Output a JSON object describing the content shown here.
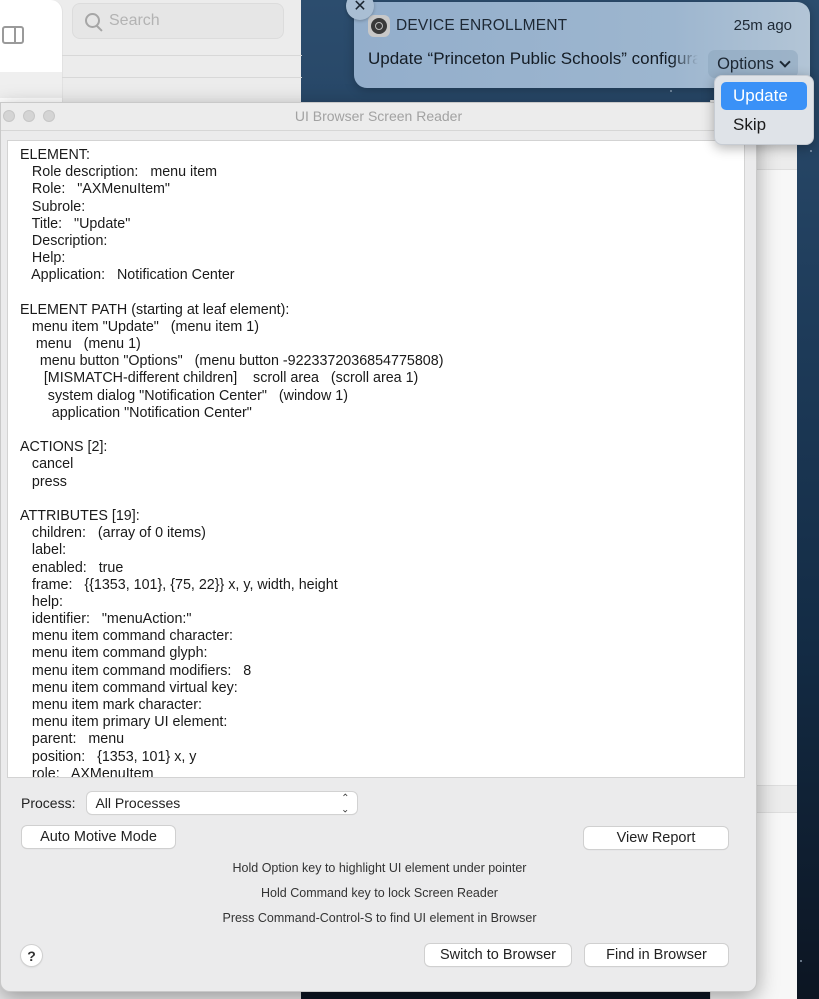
{
  "background_app": {
    "search": {
      "placeholder": "Search"
    }
  },
  "window": {
    "title": "UI Browser Screen Reader"
  },
  "reader": {
    "lines": [
      "ELEMENT:",
      "   Role description:   menu item",
      "   Role:   \"AXMenuItem\"",
      "   Subrole:",
      "   Title:   \"Update\"",
      "   Description:",
      "   Help:",
      "   Application:   Notification Center",
      "",
      "ELEMENT PATH (starting at leaf element):",
      "   menu item \"Update\"   (menu item 1)",
      "    menu   (menu 1)",
      "     menu button \"Options\"   (menu button -9223372036854775808)",
      "      [MISMATCH-different children]    scroll area   (scroll area 1)",
      "       system dialog \"Notification Center\"   (window 1)",
      "        application \"Notification Center\"",
      "",
      "ACTIONS [2]:",
      "   cancel",
      "   press",
      "",
      "ATTRIBUTES [19]:",
      "   children:   (array of 0 items)",
      "   label:",
      "   enabled:   true",
      "   frame:   {{1353, 101}, {75, 22}} x, y, width, height",
      "   help:",
      "   identifier:   \"menuAction:\"",
      "   menu item command character:",
      "   menu item command glyph:",
      "   menu item command modifiers:   8",
      "   menu item command virtual key:",
      "   menu item mark character:",
      "   menu item primary UI element:",
      "   parent:   menu",
      "   position:   {1353, 101} x, y",
      "   role:   AXMenuItem"
    ]
  },
  "controls": {
    "process_label": "Process:",
    "process_value": "All Processes",
    "auto_motive_mode": "Auto Motive Mode",
    "view_report": "View Report",
    "hints": [
      "Hold Option key to highlight UI element under pointer",
      "Hold Command key to lock Screen Reader",
      "Press Command-Control-S to find UI element in Browser"
    ],
    "help": "?",
    "switch_to_browser": "Switch to Browser",
    "find_in_browser": "Find in Browser"
  },
  "notification": {
    "app_name": "DEVICE ENROLLMENT",
    "time": "25m ago",
    "body": "Update “Princeton Public Schools” configuration",
    "options_label": "Options",
    "close_glyph": "✕",
    "menu": [
      {
        "label": "Update",
        "selected": true
      },
      {
        "label": "Skip",
        "selected": false
      }
    ]
  },
  "colors": {
    "menu_selected": "#3a91f7",
    "notification_bg": "#9db6cf"
  }
}
